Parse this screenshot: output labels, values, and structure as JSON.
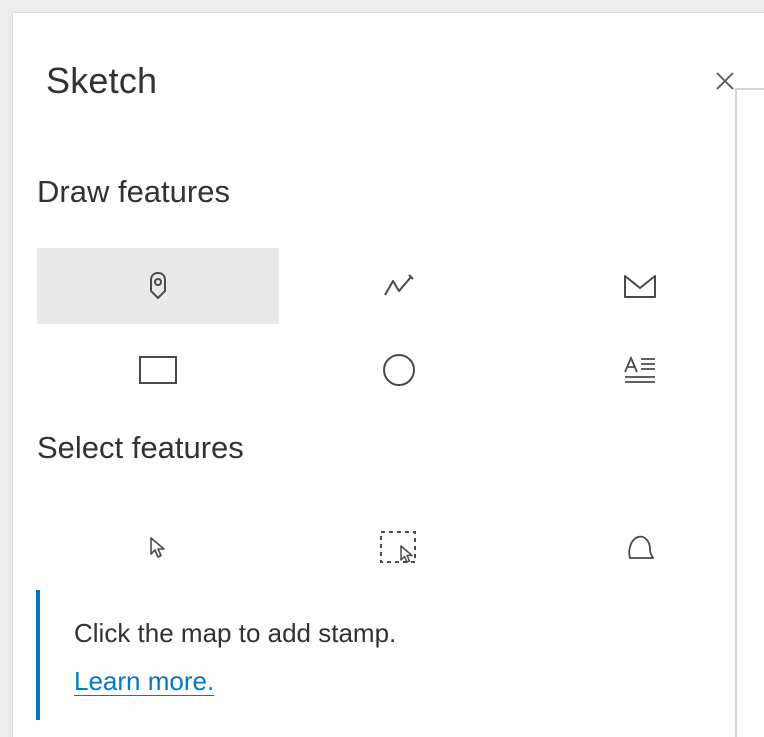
{
  "panel": {
    "title": "Sketch",
    "close_icon": "close-icon"
  },
  "draw": {
    "heading": "Draw features",
    "tools": [
      {
        "name": "point",
        "icon": "map-pin-icon",
        "active": true
      },
      {
        "name": "polyline",
        "icon": "polyline-icon",
        "active": false
      },
      {
        "name": "polygon",
        "icon": "polygon-icon",
        "active": false
      },
      {
        "name": "rectangle",
        "icon": "rectangle-icon",
        "active": false
      },
      {
        "name": "circle",
        "icon": "circle-icon",
        "active": false
      },
      {
        "name": "text",
        "icon": "text-icon",
        "active": false
      }
    ]
  },
  "select": {
    "heading": "Select features",
    "tools": [
      {
        "name": "select",
        "icon": "cursor-icon"
      },
      {
        "name": "rectangle-select",
        "icon": "rectangle-select-icon"
      },
      {
        "name": "lasso-select",
        "icon": "lasso-icon"
      }
    ]
  },
  "hint": {
    "text": "Click the map to add stamp.",
    "link": "Learn more."
  },
  "colors": {
    "accent": "#0079c1",
    "link": "#007ac2",
    "active_tool_bg": "#e9e9e9",
    "text": "#323232"
  }
}
